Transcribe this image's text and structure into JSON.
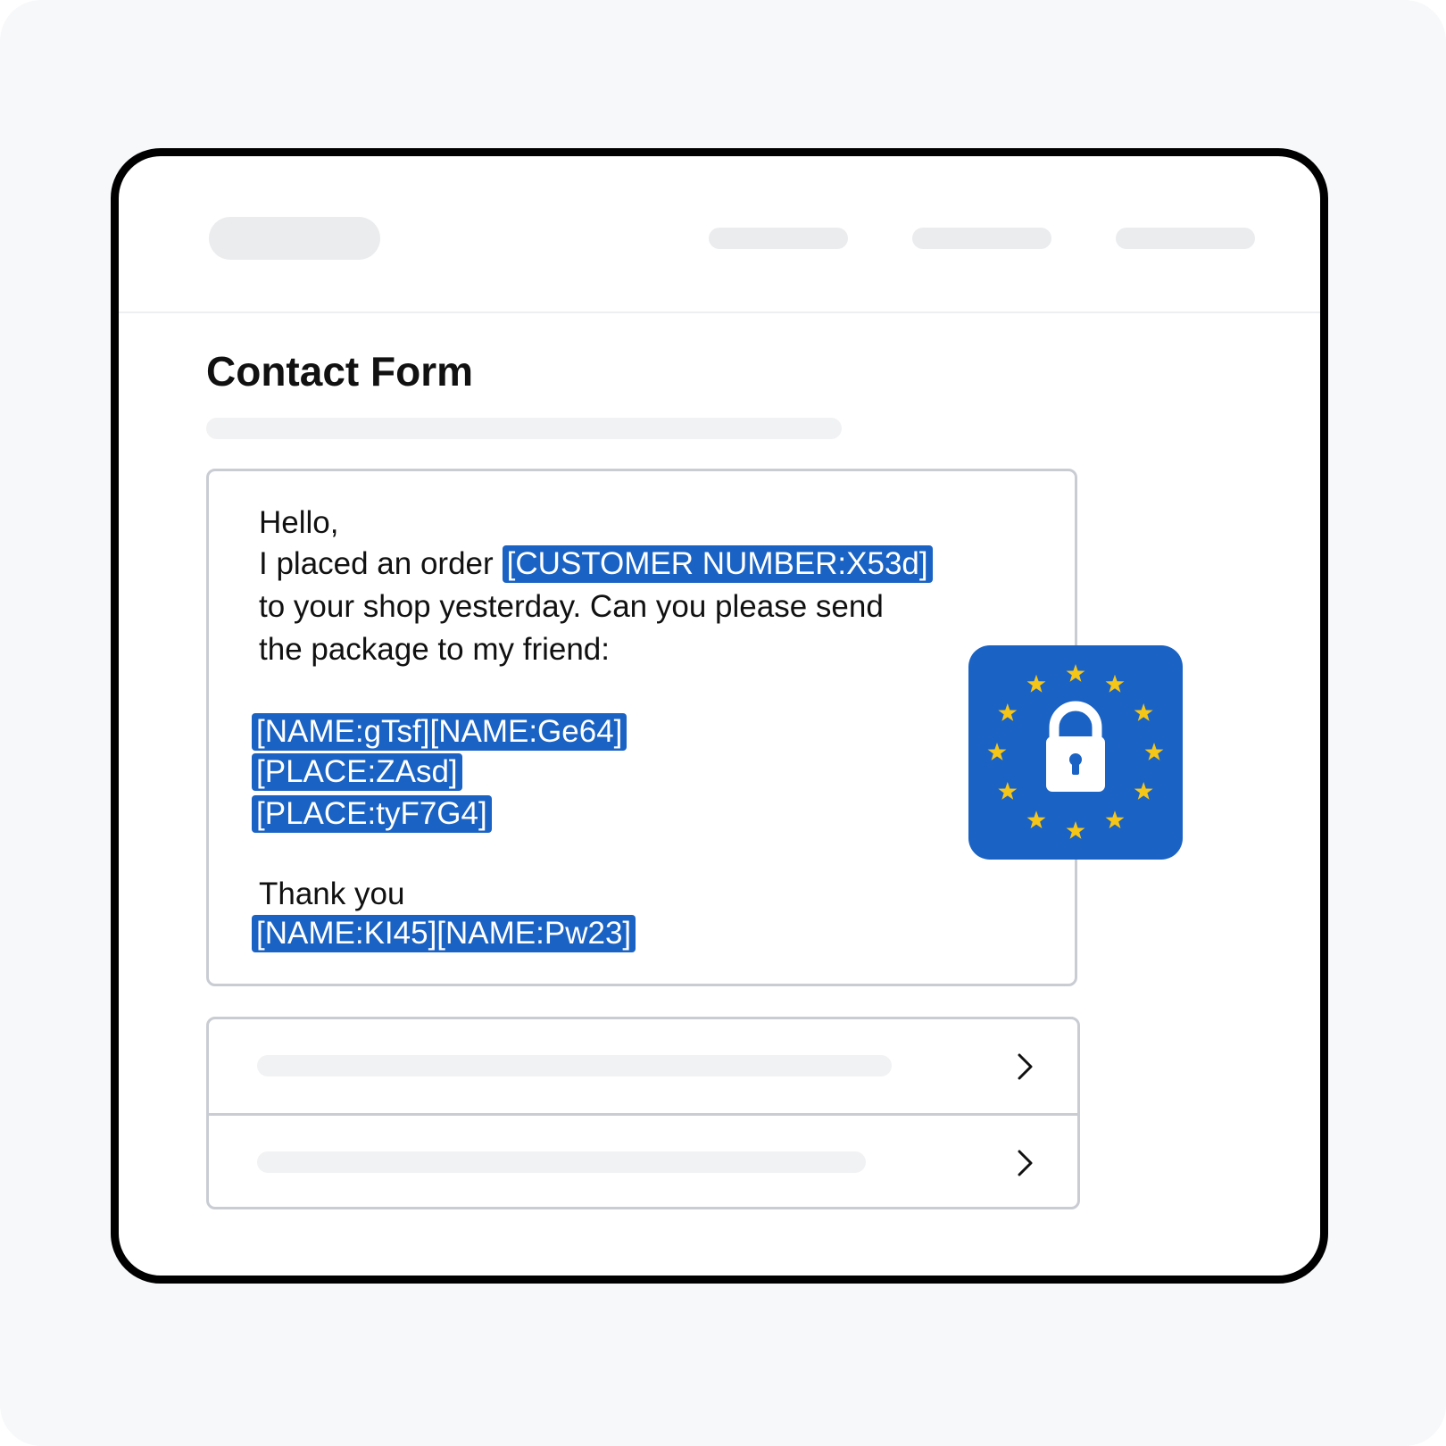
{
  "page": {
    "title": "Contact Form"
  },
  "message": {
    "greeting": "Hello,",
    "order_prefix": "I placed an order",
    "customer_tag": "[CUSTOMER NUMBER:X53d]",
    "line_shop": "to your shop yesterday. Can you please send",
    "line_package": "the package to my friend:",
    "recipient_name_tag": "[NAME:gTsf][NAME:Ge64]",
    "place_tag_1": "[PLACE:ZAsd]",
    "place_tag_2": "[PLACE:tyF7G4]",
    "closing": "Thank you",
    "sender_name_tag": "[NAME:KI45][NAME:Pw23]"
  },
  "badge": {
    "icon": "eu-lock-icon",
    "star_count": 12
  },
  "list": {
    "rows": [
      {
        "icon": "chevron-right-icon"
      },
      {
        "icon": "chevron-right-icon"
      }
    ]
  },
  "colors": {
    "page_bg": "#f7f8fa",
    "frame_border": "#000000",
    "placeholder": "#ebecee",
    "tag_bg": "#1a62c3",
    "tag_text": "#ffffff",
    "badge_bg": "#1a62c3",
    "star": "#f5c518",
    "box_border": "#c9ccd3"
  }
}
